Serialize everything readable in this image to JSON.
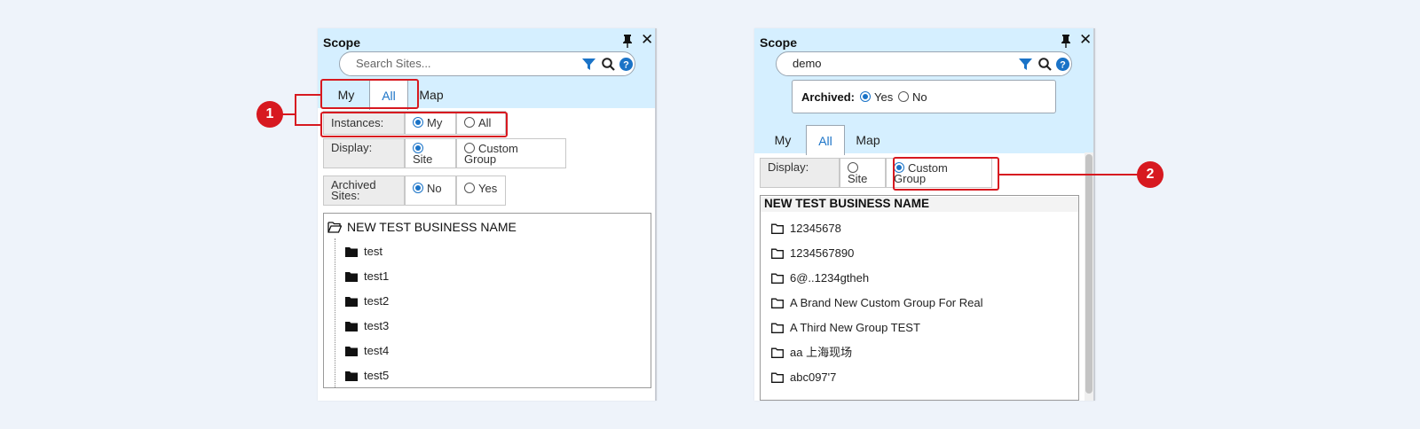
{
  "panel1": {
    "title": "Scope",
    "search_placeholder": "Search Sites...",
    "tabs": [
      "My",
      "All",
      "Map"
    ],
    "active_tab": "All",
    "instances": {
      "label": "Instances:",
      "opt_my": "My",
      "opt_all": "All"
    },
    "display": {
      "label": "Display:",
      "opt_site": "Site",
      "opt_custom_1": "Custom",
      "opt_custom_2": "Group"
    },
    "archived": {
      "label_1": "Archived",
      "label_2": "Sites:",
      "opt_no": "No",
      "opt_yes": "Yes"
    },
    "tree_root": "NEW TEST BUSINESS NAME",
    "tree_items": [
      "test",
      "test1",
      "test2",
      "test3",
      "test4",
      "test5"
    ]
  },
  "panel2": {
    "title": "Scope",
    "search_value": "demo",
    "archived": {
      "label": "Archived:",
      "opt_yes": "Yes",
      "opt_no": "No"
    },
    "tabs": [
      "My",
      "All",
      "Map"
    ],
    "active_tab": "All",
    "display": {
      "label": "Display:",
      "opt_site": "Site",
      "opt_custom_1": "Custom",
      "opt_custom_2": "Group"
    },
    "tree_root": "NEW TEST BUSINESS NAME",
    "tree_items": [
      "12345678",
      "1234567890",
      "6@..1234gtheh",
      "A Brand New Custom Group For Real",
      "A Third New Group TEST",
      "aa 上海现场",
      "abc097'7"
    ]
  },
  "callouts": [
    "1",
    "2"
  ],
  "colors": {
    "header": "#d5efff",
    "accent": "#1a73c7",
    "highlight": "#d71920"
  }
}
